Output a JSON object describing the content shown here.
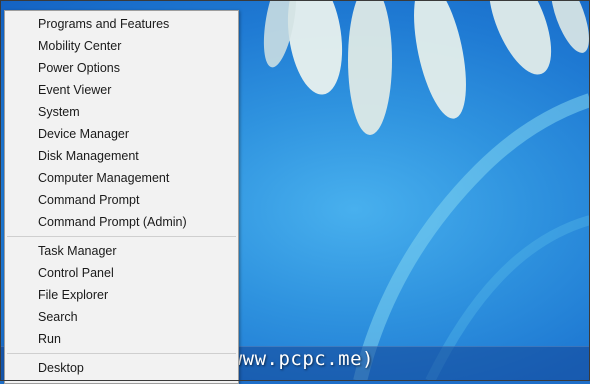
{
  "context_menu": {
    "group1": [
      {
        "label": "Programs and Features"
      },
      {
        "label": "Mobility Center"
      },
      {
        "label": "Power Options"
      },
      {
        "label": "Event Viewer"
      },
      {
        "label": "System"
      },
      {
        "label": "Device Manager"
      },
      {
        "label": "Disk Management"
      },
      {
        "label": "Computer Management"
      },
      {
        "label": "Command Prompt"
      },
      {
        "label": "Command Prompt (Admin)"
      }
    ],
    "group2": [
      {
        "label": "Task Manager"
      },
      {
        "label": "Control Panel"
      },
      {
        "label": "File Explorer"
      },
      {
        "label": "Search"
      },
      {
        "label": "Run"
      }
    ],
    "group3": [
      {
        "label": "Desktop"
      }
    ]
  },
  "watermark": {
    "text": "双电网(www.pcpc.me)"
  },
  "colors": {
    "menu_background": "#f2f2f2",
    "desktop_blue": "#2f93df",
    "menu_text": "#1a1a1a"
  }
}
